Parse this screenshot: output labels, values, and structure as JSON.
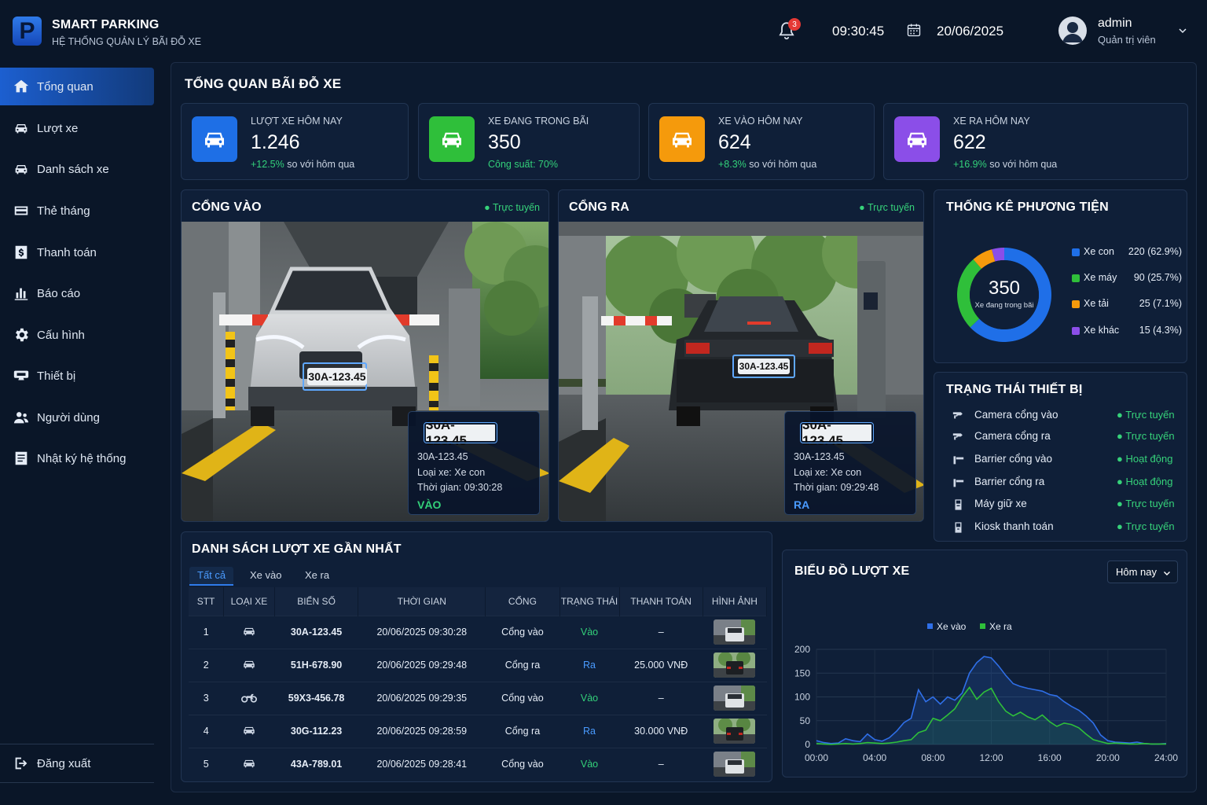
{
  "header": {
    "logo_letter": "P",
    "app_title": "SMART PARKING",
    "app_subtitle": "HỆ THỐNG QUẢN LÝ BÃI ĐỖ XE",
    "notification_count": "3",
    "time": "09:30:45",
    "date": "20/06/2025",
    "user_name": "admin",
    "user_role": "Quản trị viên"
  },
  "sidebar": {
    "items": [
      {
        "label": "Tổng quan",
        "icon": "home-icon",
        "active": true
      },
      {
        "label": "Lượt xe",
        "icon": "car-icon"
      },
      {
        "label": "Danh sách xe",
        "icon": "car-icon"
      },
      {
        "label": "Thẻ tháng",
        "icon": "card-icon"
      },
      {
        "label": "Thanh toán",
        "icon": "dollar-icon"
      },
      {
        "label": "Báo cáo",
        "icon": "bar-chart-icon"
      },
      {
        "label": "Cấu hình",
        "icon": "gear-icon"
      },
      {
        "label": "Thiết bị",
        "icon": "device-icon"
      },
      {
        "label": "Người dùng",
        "icon": "users-icon"
      },
      {
        "label": "Nhật ký hệ thống",
        "icon": "log-icon"
      }
    ],
    "logout_label": "Đăng xuất"
  },
  "main": {
    "title": "TỔNG QUAN BÃI ĐỖ XE"
  },
  "stats": [
    {
      "label": "LƯỢT XE HÔM NAY",
      "value": "1.246",
      "delta": "+12.5%",
      "delta_text": " so với hôm qua",
      "color": "#1e6fe6"
    },
    {
      "label": "XE ĐANG TRONG BÃI",
      "value": "350",
      "delta": "Công suất: 70%",
      "delta_text": "",
      "color": "#2fbf3a"
    },
    {
      "label": "XE VÀO HÔM NAY",
      "value": "624",
      "delta": "+8.3%",
      "delta_text": " so với hôm qua",
      "color": "#f59a0c"
    },
    {
      "label": "XE RA HÔM NAY",
      "value": "622",
      "delta": "+16.9%",
      "delta_text": " so với hôm qua",
      "color": "#8b4ee8"
    }
  ],
  "gates": [
    {
      "title": "CỔNG VÀO",
      "status": "Trực tuyến",
      "plate_on_car": "30A-123.45",
      "plate": "30A-123.45",
      "plate_info": "30A-123.45",
      "type": "Loại xe: Xe con",
      "time": "Thời gian: 09:30:28",
      "direction": "VÀO",
      "direction_color": "#33d17a"
    },
    {
      "title": "CỔNG RA",
      "status": "Trực tuyến",
      "plate_on_car": "30A-123.45",
      "plate": "30A-123.45",
      "plate_info": "30A-123.45",
      "type": "Loại xe: Xe con",
      "time": "Thời gian: 09:29:48",
      "direction": "RA",
      "direction_color": "#4a9bff"
    }
  ],
  "vehicle_stats": {
    "title": "THỐNG KÊ PHƯƠNG TIỆN",
    "center_value": "350",
    "center_label": "Xe đang trong bãi",
    "segments": [
      {
        "name": "Xe con",
        "value": 220,
        "text": "220 (62.9%)",
        "color": "#1f6fe8"
      },
      {
        "name": "Xe máy",
        "value": 90,
        "text": "90 (25.7%)",
        "color": "#2fbf3a"
      },
      {
        "name": "Xe tải",
        "value": 25,
        "text": "25 (7.1%)",
        "color": "#f59a0c"
      },
      {
        "name": "Xe khác",
        "value": 15,
        "text": "15 (4.3%)",
        "color": "#8b4ee8"
      }
    ]
  },
  "devices": {
    "title": "TRẠNG THÁI THIẾT BỊ",
    "items": [
      {
        "name": "Camera cổng vào",
        "status": "Trực tuyến",
        "icon": "camera-icon"
      },
      {
        "name": "Camera cổng ra",
        "status": "Trực tuyến",
        "icon": "camera-icon"
      },
      {
        "name": "Barrier cổng vào",
        "status": "Hoạt động",
        "icon": "barrier-icon"
      },
      {
        "name": "Barrier cổng ra",
        "status": "Hoạt động",
        "icon": "barrier-icon"
      },
      {
        "name": "Máy giữ xe",
        "status": "Trực tuyến",
        "icon": "ticket-machine-icon"
      },
      {
        "name": "Kiosk thanh toán",
        "status": "Trực tuyến",
        "icon": "kiosk-icon"
      }
    ]
  },
  "recent": {
    "title": "DANH SÁCH LƯỢT XE GẦN NHẤT",
    "tabs": [
      "Tất cả",
      "Xe vào",
      "Xe ra"
    ],
    "columns": [
      "STT",
      "LOẠI XE",
      "BIỂN SỐ",
      "THỜI GIAN",
      "CỔNG",
      "TRẠNG THÁI",
      "THANH TOÁN",
      "HÌNH ẢNH"
    ],
    "rows": [
      {
        "stt": "1",
        "icon": "car-icon",
        "plate": "30A-123.45",
        "time": "20/06/2025 09:30:28",
        "gate": "Cổng vào",
        "status": "Vào",
        "dir": "in",
        "pay": "–"
      },
      {
        "stt": "2",
        "icon": "car-icon",
        "plate": "51H-678.90",
        "time": "20/06/2025 09:29:48",
        "gate": "Cổng ra",
        "status": "Ra",
        "dir": "out",
        "pay": "25.000 VNĐ"
      },
      {
        "stt": "3",
        "icon": "motorbike-icon",
        "plate": "59X3-456.78",
        "time": "20/06/2025 09:29:35",
        "gate": "Cổng vào",
        "status": "Vào",
        "dir": "in",
        "pay": "–"
      },
      {
        "stt": "4",
        "icon": "car-icon",
        "plate": "30G-112.23",
        "time": "20/06/2025 09:28:59",
        "gate": "Cổng ra",
        "status": "Ra",
        "dir": "out",
        "pay": "30.000 VNĐ"
      },
      {
        "stt": "5",
        "icon": "car-icon",
        "plate": "43A-789.01",
        "time": "20/06/2025 09:28:41",
        "gate": "Cổng vào",
        "status": "Vào",
        "dir": "in",
        "pay": "–"
      }
    ]
  },
  "traffic": {
    "title": "BIỂU ĐỒ LƯỢT XE",
    "range": "Hôm nay"
  },
  "chart_data": {
    "type": "line",
    "title": "BIỂU ĐỒ LƯỢT XE",
    "xlabel": "",
    "ylabel": "",
    "ylim": [
      0,
      200
    ],
    "xlim": [
      0,
      24
    ],
    "x_ticks": [
      "00:00",
      "04:00",
      "08:00",
      "12:00",
      "16:00",
      "20:00",
      "24:00"
    ],
    "y_ticks": [
      0,
      50,
      100,
      150,
      200
    ],
    "legend": "top-center",
    "grid": true,
    "x": [
      0,
      0.5,
      1,
      1.5,
      2,
      2.5,
      3,
      3.5,
      4,
      4.5,
      5,
      5.5,
      6,
      6.5,
      7,
      7.5,
      8,
      8.5,
      9,
      9.5,
      10,
      10.5,
      11,
      11.5,
      12,
      12.5,
      13,
      13.5,
      14,
      14.5,
      15,
      15.5,
      16,
      16.5,
      17,
      17.5,
      18,
      18.5,
      19,
      19.5,
      20,
      20.5,
      21,
      21.5,
      22,
      22.5,
      23,
      23.5,
      24
    ],
    "series": [
      {
        "name": "Xe vào",
        "color": "#2f6fe8",
        "values": [
          8,
          4,
          2,
          3,
          12,
          8,
          6,
          22,
          10,
          7,
          14,
          28,
          46,
          55,
          115,
          90,
          100,
          85,
          100,
          93,
          108,
          150,
          172,
          185,
          182,
          165,
          145,
          128,
          122,
          118,
          115,
          112,
          105,
          102,
          90,
          80,
          72,
          60,
          45,
          20,
          8,
          5,
          4,
          3,
          5,
          2,
          1,
          1,
          2
        ]
      },
      {
        "name": "Xe ra",
        "color": "#2fbf3a",
        "values": [
          2,
          1,
          0,
          1,
          2,
          1,
          2,
          4,
          3,
          2,
          3,
          5,
          8,
          10,
          25,
          30,
          55,
          50,
          62,
          75,
          100,
          120,
          95,
          110,
          118,
          90,
          70,
          60,
          68,
          58,
          52,
          62,
          48,
          38,
          45,
          42,
          35,
          22,
          10,
          6,
          2,
          3,
          2,
          1,
          1,
          2,
          1,
          1,
          1
        ]
      }
    ]
  }
}
